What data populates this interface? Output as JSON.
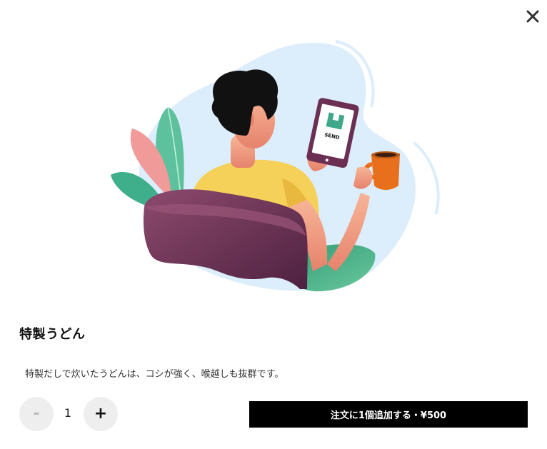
{
  "modal": {
    "close_icon": "close-icon",
    "illustration": {
      "tablet_brand_text": "SEND",
      "colors": {
        "blob": "#dcedfb",
        "sofa": "#7a3b5e",
        "shirt": "#f6d15a",
        "hair": "#111111",
        "mug": "#e8701d",
        "tablet": "#6b2f53",
        "leaf_green": "#3fae8a",
        "leaf_pink": "#f09a9a"
      }
    },
    "product": {
      "title": "特製うどん",
      "description": "特製だしで炊いたうどんは、コシが強く、喉越しも抜群です。"
    },
    "quantity": {
      "minus_label": "-",
      "value": "1",
      "plus_label": "+"
    },
    "add_button_label": "注文に1個追加する・¥500"
  }
}
